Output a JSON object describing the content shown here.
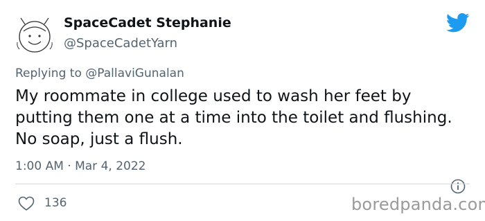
{
  "tweet": {
    "author": {
      "display_name": "SpaceCadet Stephanie",
      "handle": "@SpaceCadetYarn",
      "avatar_icon": "smiley-face-astronaut-drawing"
    },
    "replying_to_label": "Replying to",
    "replying_to_handle": "@PallaviGunalan",
    "text": "My roommate in college used to wash her feet by putting them one at a time into the toilet and flushing. No soap, just a flush.",
    "timestamp": "1:00 AM · Mar 4, 2022",
    "like_count": "136"
  },
  "icons": {
    "brand": "twitter-bird-icon",
    "info": "info-icon",
    "like": "heart-icon"
  },
  "colors": {
    "twitter_blue": "#1d9bf0",
    "secondary_text": "#536471",
    "primary_text": "#0f1419"
  },
  "watermark": "boredpanda.com"
}
